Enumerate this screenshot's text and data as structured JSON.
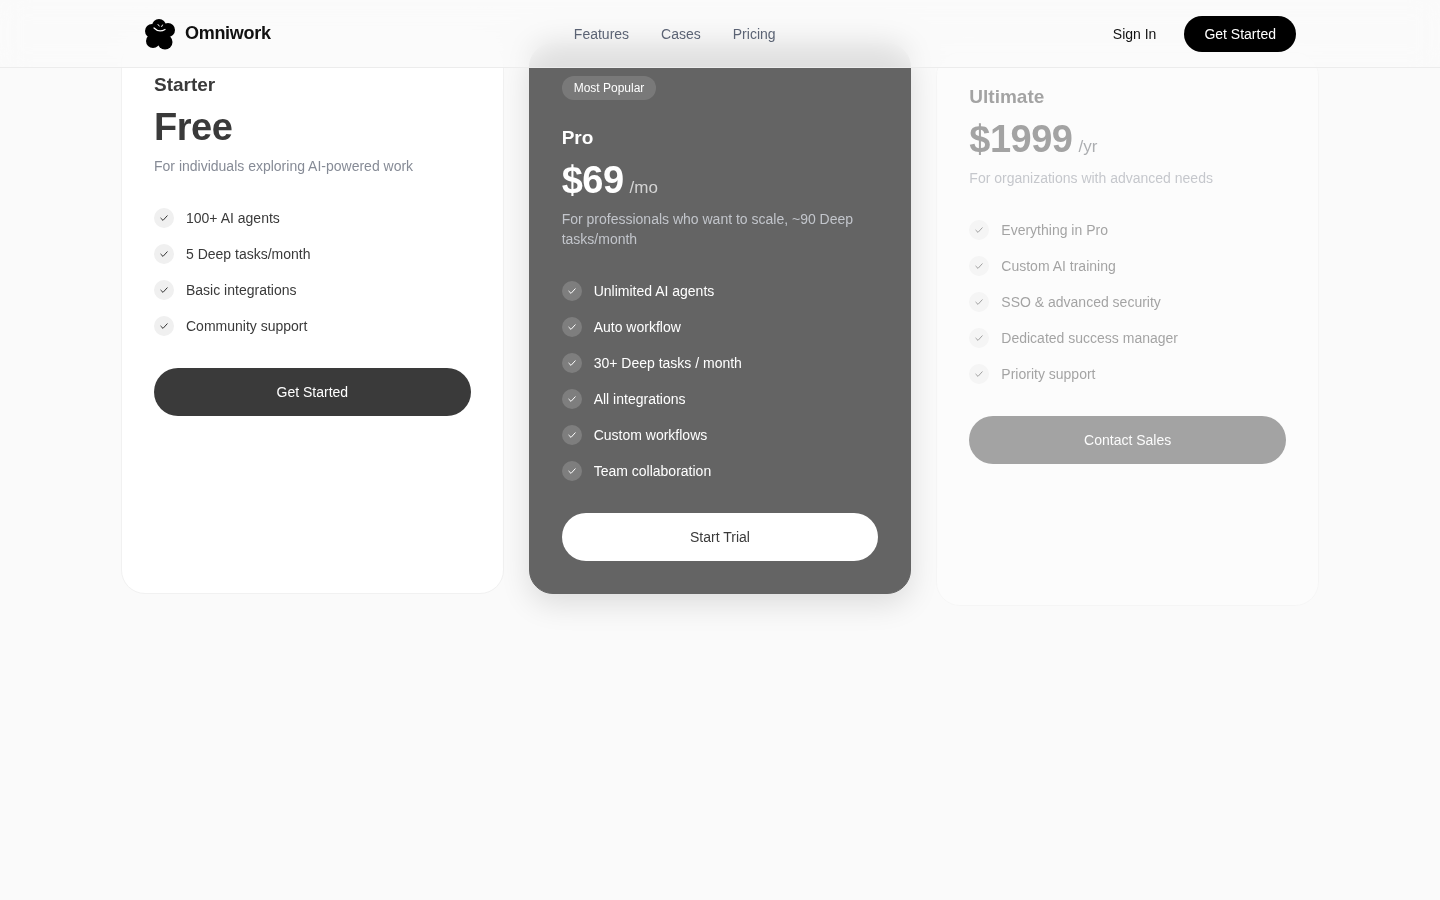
{
  "header": {
    "logo": "Omniwork",
    "nav": [
      {
        "label": "Features"
      },
      {
        "label": "Cases"
      },
      {
        "label": "Pricing"
      }
    ],
    "sign_in": "Sign In",
    "cta": "Get Started"
  },
  "plans": [
    {
      "name": "Starter",
      "price": "Free",
      "description": "For individuals exploring AI-powered work",
      "features": [
        "100+ AI agents",
        "5 Deep tasks/month",
        "Basic integrations",
        "Community support"
      ],
      "button": "Get Started",
      "highlighted": false,
      "dimmed": false
    },
    {
      "badge": "Most Popular",
      "name": "Pro",
      "price": "$69",
      "period": "/mo",
      "description": "For professionals who want to scale, ~90 Deep tasks/month",
      "features": [
        "Unlimited AI agents",
        "Auto workflow",
        "30+ Deep tasks / month",
        "All integrations",
        "Custom workflows",
        "Team collaboration"
      ],
      "button": "Start Trial",
      "highlighted": true,
      "dimmed": false
    },
    {
      "name": "Ultimate",
      "price": "$1999",
      "period": "/yr",
      "description": "For organizations with advanced needs",
      "features": [
        "Everything in Pro",
        "Custom AI training",
        "SSO & advanced security",
        "Dedicated success manager",
        "Priority support"
      ],
      "button": "Contact Sales",
      "highlighted": false,
      "dimmed": true
    }
  ]
}
